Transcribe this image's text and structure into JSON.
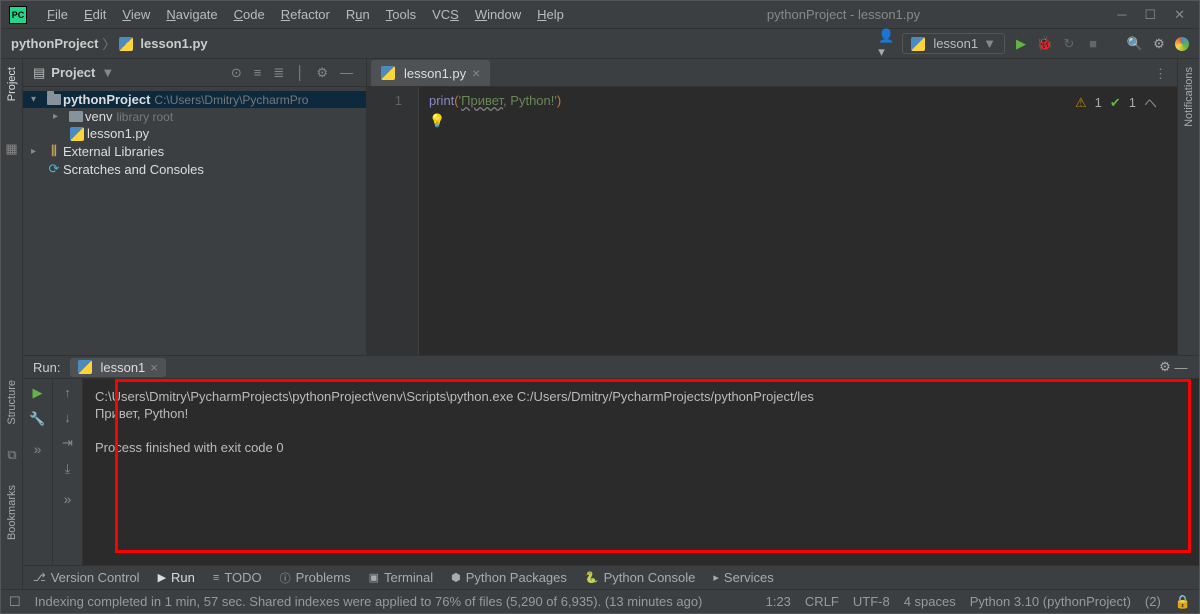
{
  "window": {
    "title": "pythonProject - lesson1.py"
  },
  "menu": [
    "File",
    "Edit",
    "View",
    "Navigate",
    "Code",
    "Refactor",
    "Run",
    "Tools",
    "VCS",
    "Window",
    "Help"
  ],
  "breadcrumb": {
    "project": "pythonProject",
    "file": "lesson1.py"
  },
  "runConfig": {
    "label": "lesson1"
  },
  "projectPanel": {
    "title": "Project",
    "root": {
      "name": "pythonProject",
      "path": "C:\\Users\\Dmitry\\PycharmPro"
    },
    "venv": {
      "name": "venv",
      "hint": "library root"
    },
    "file": "lesson1.py",
    "ext": "External Libraries",
    "scratch": "Scratches and Consoles"
  },
  "editor": {
    "tab": "lesson1.py",
    "lineNo": "1",
    "code": {
      "fn": "print",
      "open": "(",
      "q1": "'",
      "ru": "Привет",
      "comma": ", ",
      "py": "Python!",
      "q2": "'",
      "close": ")"
    },
    "warnCount": "1",
    "checkCount": "1"
  },
  "run": {
    "label": "Run:",
    "tab": "lesson1",
    "output": {
      "line1": "C:\\Users\\Dmitry\\PycharmProjects\\pythonProject\\venv\\Scripts\\python.exe C:/Users/Dmitry/PycharmProjects/pythonProject/les",
      "line2": "Привет, Python!",
      "line3": "",
      "line4": "Process finished with exit code 0"
    }
  },
  "bottomTools": {
    "vcs": "Version Control",
    "run": "Run",
    "todo": "TODO",
    "problems": "Problems",
    "terminal": "Terminal",
    "pkg": "Python Packages",
    "console": "Python Console",
    "services": "Services"
  },
  "status": {
    "msg": "Indexing completed in 1 min, 57 sec. Shared indexes were applied to 76% of files (5,290 of 6,935). (13 minutes ago)",
    "pos": "1:23",
    "le": "CRLF",
    "enc": "UTF-8",
    "indent": "4 spaces",
    "interp": "Python 3.10 (pythonProject)",
    "notif": "(2)"
  },
  "leftRail": {
    "project": "Project",
    "structure": "Structure",
    "bookmarks": "Bookmarks"
  },
  "rightRail": {
    "notif": "Notifications"
  }
}
